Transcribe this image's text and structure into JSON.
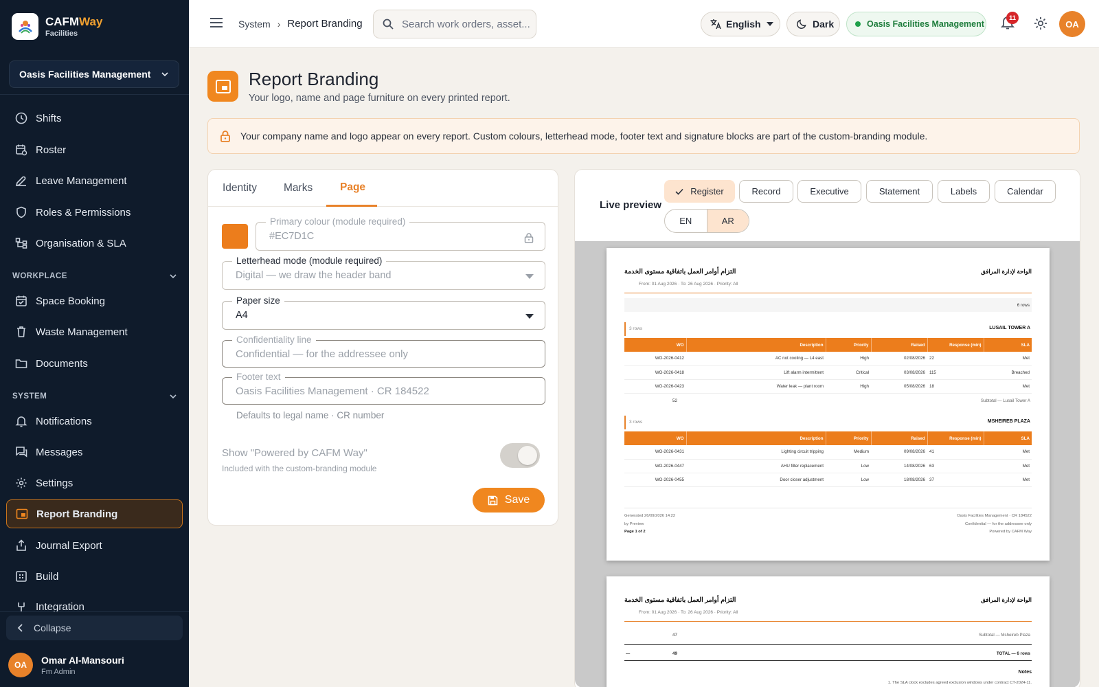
{
  "app": {
    "name": "CAFM",
    "name_accent": "Way",
    "sub": "Facilities",
    "org": "Oasis Facilities Management"
  },
  "sidebar": {
    "items_top": [
      {
        "label": "Shifts"
      },
      {
        "label": "Roster"
      },
      {
        "label": "Leave Management"
      },
      {
        "label": "Roles & Permissions"
      },
      {
        "label": "Organisation & SLA"
      }
    ],
    "workplace_title": "WORKPLACE",
    "workplace": [
      {
        "label": "Space Booking"
      },
      {
        "label": "Waste Management"
      },
      {
        "label": "Documents"
      }
    ],
    "system_title": "SYSTEM",
    "system": [
      {
        "label": "Notifications"
      },
      {
        "label": "Messages"
      },
      {
        "label": "Settings"
      },
      {
        "label": "Report Branding"
      },
      {
        "label": "Journal Export"
      },
      {
        "label": "Build"
      },
      {
        "label": "Integration"
      }
    ],
    "collapse": "Collapse",
    "user": {
      "initials": "OA",
      "name": "Omar Al-Mansouri",
      "role": "Fm Admin"
    }
  },
  "topbar": {
    "breadcrumb": {
      "parent": "System",
      "current": "Report Branding"
    },
    "search_placeholder": "Search work orders, asset...",
    "language": "English",
    "theme": "Dark",
    "org": "Oasis Facilities Management",
    "notif_count": "11",
    "avatar": "OA"
  },
  "page": {
    "title": "Report Branding",
    "subtitle": "Your logo, name and page furniture on every printed report.",
    "notice": "Your company name and logo appear on every report. Custom colours, letterhead mode, footer text and signature blocks are part of the custom-branding module."
  },
  "settings": {
    "tabs": [
      "Identity",
      "Marks",
      "Page"
    ],
    "primary": {
      "label": "Primary colour (module required)",
      "value": "#EC7D1C",
      "color": "#EC7D1C"
    },
    "letterhead": {
      "label": "Letterhead mode (module required)",
      "value": "Digital — we draw the header band"
    },
    "paper": {
      "label": "Paper size",
      "value": "A4"
    },
    "confidentiality": {
      "label": "Confidentiality line",
      "placeholder": "Confidential — for the addressee only"
    },
    "footer": {
      "label": "Footer text",
      "placeholder": "Oasis Facilities Management · CR 184522",
      "helper": "Defaults to legal name · CR number"
    },
    "powered": {
      "label": "Show \"Powered by CAFM Way\"",
      "sub": "Included with the custom-branding module",
      "on": true
    },
    "save": "Save"
  },
  "preview": {
    "label": "Live preview",
    "templates": [
      "Register",
      "Record",
      "Executive",
      "Statement",
      "Labels",
      "Calendar"
    ],
    "active_template": "Register",
    "langs": [
      "EN",
      "AR"
    ],
    "active_lang": "AR",
    "page1": {
      "title": "التزام أوامر العمل باتفاقية مستوى الخدمة",
      "org": "الواحة لإدارة المرافق",
      "meta": "From: 01 Aug 2026  ·  To: 26 Aug 2026  ·  Priority: All",
      "rows_count": "6 rows",
      "columns": [
        "WO",
        "Description",
        "Priority",
        "Raised",
        "Response (min)",
        "SLA"
      ],
      "groups": [
        {
          "count": "3 rows",
          "name": "LUSAIL TOWER A",
          "rows": [
            [
              "WO-2026-0412",
              "AC not cooling — L4 east",
              "High",
              "02/08/2026",
              "22",
              "Met"
            ],
            [
              "WO-2026-0418",
              "Lift alarm intermittent",
              "Critical",
              "03/08/2026",
              "115",
              "Breached"
            ],
            [
              "WO-2026-0423",
              "Water leak — plant room",
              "High",
              "05/08/2026",
              "18",
              "Met"
            ]
          ],
          "subtotal_value": "52",
          "subtotal_label": "Subtotal — Lusail Tower A"
        },
        {
          "count": "3 rows",
          "name": "MSHEIREB PLAZA",
          "rows": [
            [
              "WO-2026-0431",
              "Lighting circuit tripping",
              "Medium",
              "09/08/2026",
              "41",
              "Met"
            ],
            [
              "WO-2026-0447",
              "AHU filter replacement",
              "Low",
              "14/08/2026",
              "63",
              "Met"
            ],
            [
              "WO-2026-0455",
              "Door closer adjustment",
              "Low",
              "18/08/2026",
              "37",
              "Met"
            ]
          ]
        }
      ],
      "footer_left": [
        "Generated 26/09/2026 14:22",
        "by Preview",
        "Page 1 of 2"
      ],
      "footer_right": [
        "Oasis Facilities Management · CR 184522",
        "Confidential — for the addressee only",
        "Powered by CAFM Way"
      ]
    },
    "page2": {
      "subtotal_value": "47",
      "subtotal_label": "Subtotal — Msheireb Plaza",
      "total_dash": "—",
      "total_value": "49",
      "total_label": "TOTAL — 6 rows",
      "notes_title": "Notes",
      "note1": "1. The SLA clock excludes agreed exclusion windows under contract CT-2024-11."
    }
  }
}
